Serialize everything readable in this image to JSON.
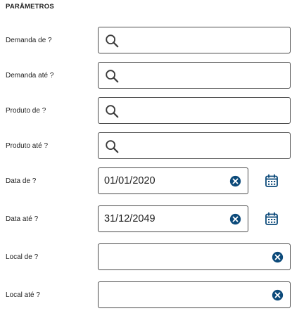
{
  "section": {
    "title": "PARÂMETROS"
  },
  "params": [
    {
      "label": "Demanda de ?",
      "value": "",
      "icon": "search-icon"
    },
    {
      "label": "Demanda até ?",
      "value": "",
      "icon": "search-icon"
    },
    {
      "label": "Produto de ?",
      "value": "",
      "icon": "search-icon"
    },
    {
      "label": "Produto até ?",
      "value": "",
      "icon": "search-icon"
    },
    {
      "label": "Data de ?",
      "value": "01/01/2020",
      "icon": "clear-icon",
      "extra_icon": "calendar-icon"
    },
    {
      "label": "Data até ?",
      "value": "31/12/2049",
      "icon": "clear-icon",
      "extra_icon": "calendar-icon"
    },
    {
      "label": "Local de ?",
      "value": "",
      "icon": "clear-icon"
    },
    {
      "label": "Local até ?",
      "value": "",
      "icon": "clear-icon"
    }
  ],
  "colors": {
    "accent": "#0c4a7a",
    "border": "#4a4a4a",
    "text": "#1d1d1d"
  }
}
